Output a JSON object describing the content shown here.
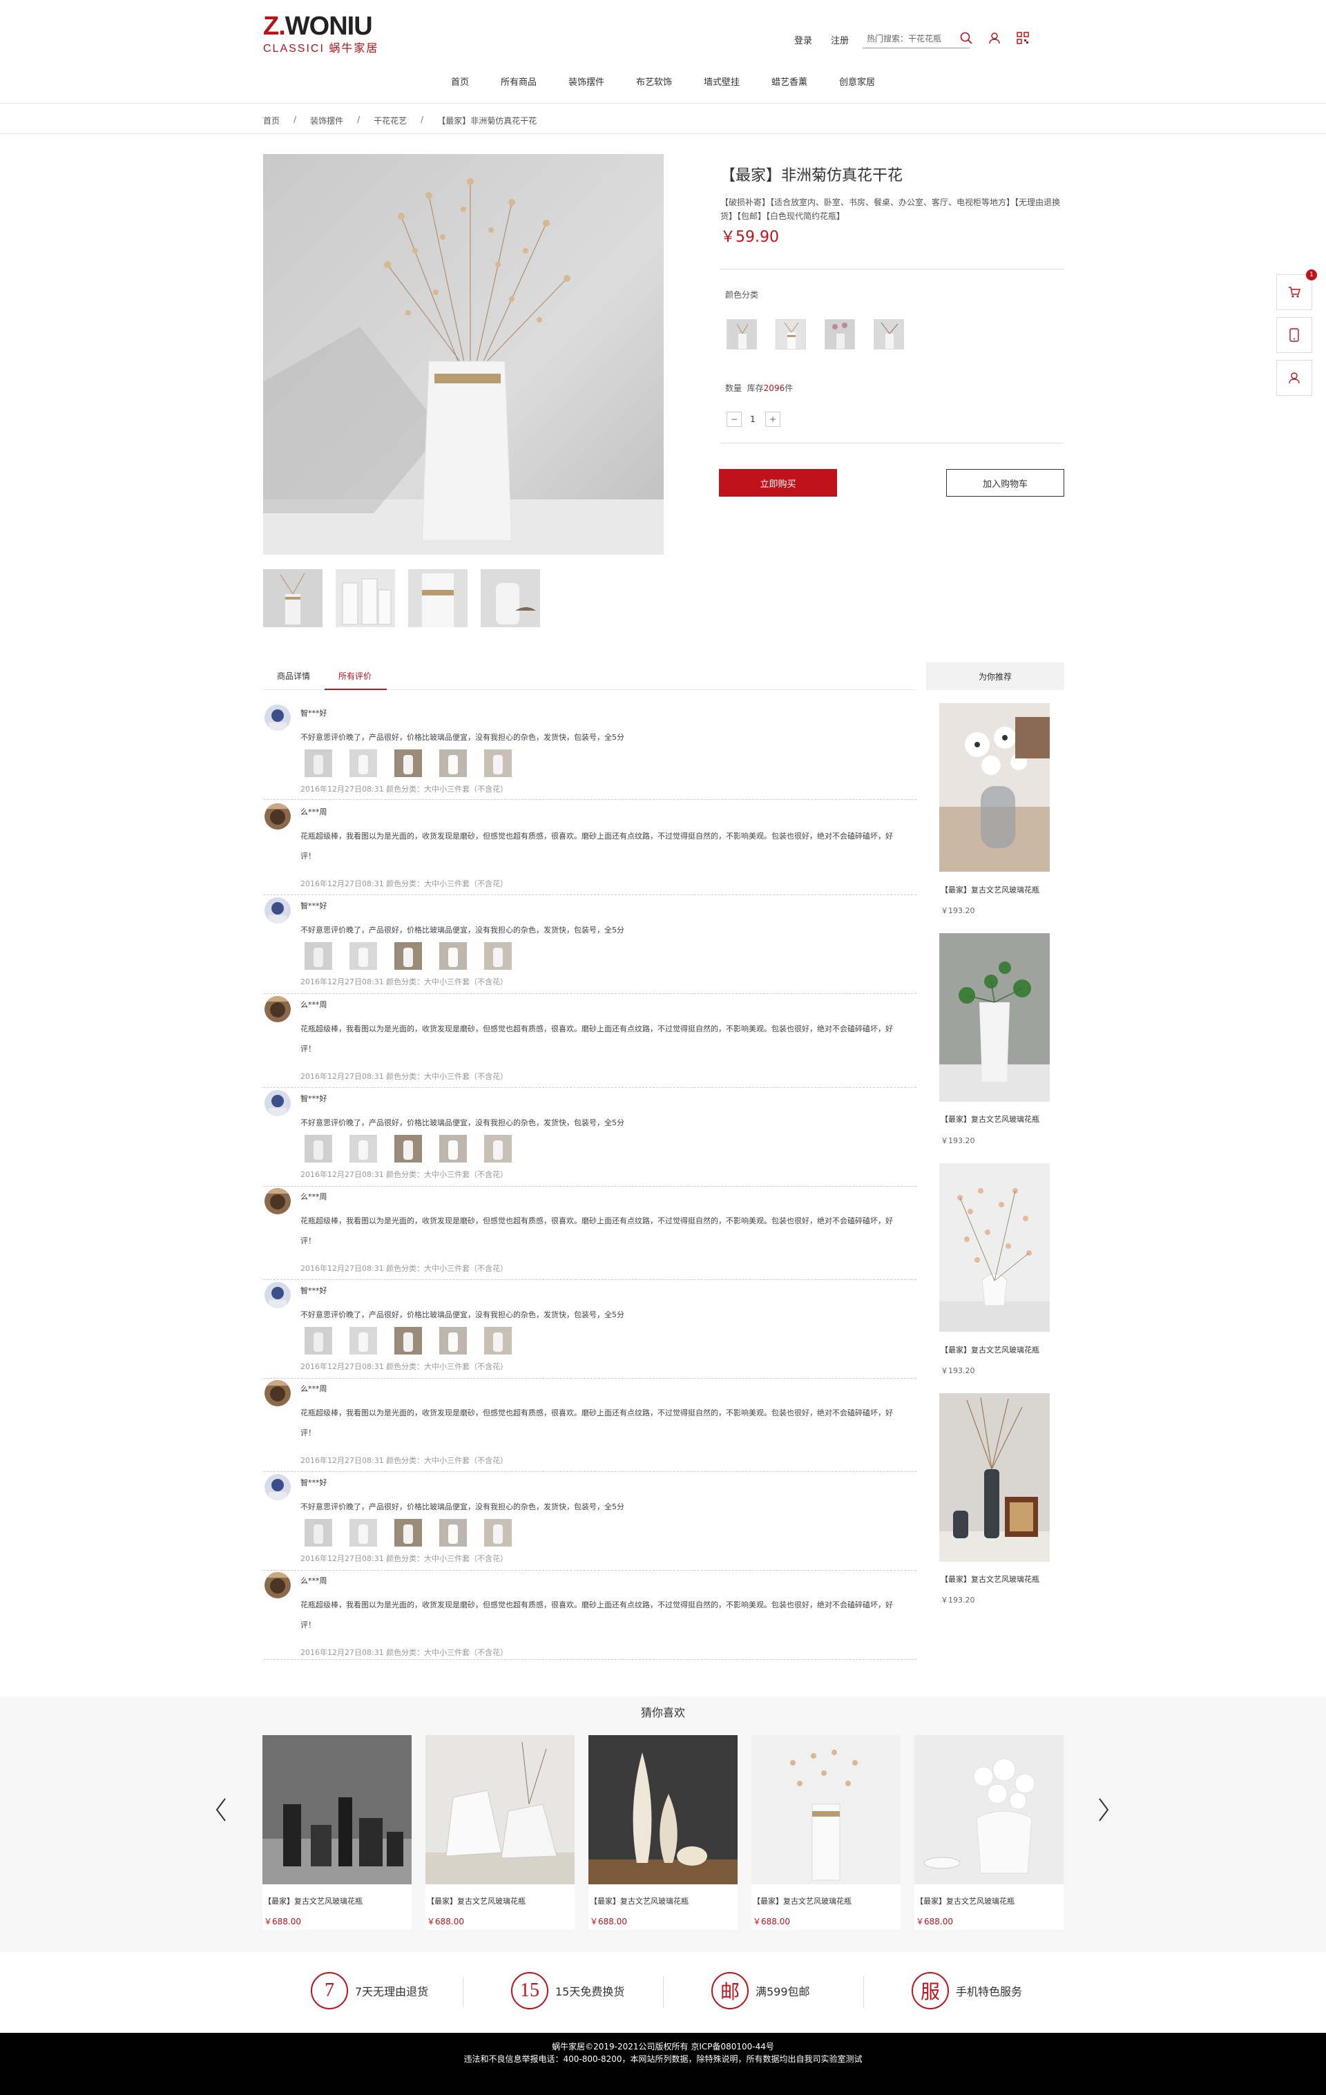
{
  "header": {
    "logo_main": "WONIU",
    "logo_letter": "Z.",
    "logo_sub": "CLASSICI 蜗牛家居",
    "login": "登录",
    "register": "注册",
    "search_text": "热门搜索：干花花瓶"
  },
  "nav": [
    "首页",
    "所有商品",
    "装饰摆件",
    "布艺软饰",
    "墙式壁挂",
    "蜡艺香薰",
    "创意家居"
  ],
  "breadcrumb": [
    "首页",
    "装饰摆件",
    "干花花艺",
    "【最家】非洲菊仿真花干花"
  ],
  "product": {
    "title": "【最家】非洲菊仿真花干花",
    "desc": "【破损补寄】【适合放室内、卧室、书房、餐桌、办公室、客厅、电视柜等地方】【无理由退换货】【包邮】【白色现代简约花瓶】",
    "price": "￥59.90",
    "color_label": "颜色分类",
    "qty_label": "数量",
    "stock_prefix": "库存",
    "stock_num": "2096",
    "stock_unit": "件",
    "qty": "1",
    "minus": "−",
    "plus": "+",
    "buy": "立即购买",
    "cart": "加入购物车"
  },
  "side_badge": "1",
  "tabs": [
    "商品详情",
    "所有评价"
  ],
  "reviews": {
    "a": {
      "name": "智***好",
      "text": "不好意思评价晚了，产品很好，价格比玻璃品便宜，没有我担心的杂色，发货快，包装号，全5分",
      "meta": "2016年12月27日08:31    颜色分类：大中小三件套（不含花）"
    },
    "b": {
      "name": "么***周",
      "text": "花瓶超级棒，我看图以为是光面的，收货发现是磨砂，但感觉也超有质感，很喜欢。磨砂上面还有点纹路，不过觉得挺自然的，不影响美观。包装也很好，绝对不会磕碎磕坏，好评！",
      "meta": "2016年12月27日08:31    颜色分类：大中小三件套（不含花）"
    }
  },
  "recommend": {
    "title": "为你推荐",
    "items": [
      {
        "name": "【最家】复古文艺风玻璃花瓶",
        "price": "￥193.20"
      },
      {
        "name": "【最家】复古文艺风玻璃花瓶",
        "price": "￥193.20"
      },
      {
        "name": "【最家】复古文艺风玻璃花瓶",
        "price": "￥193.20"
      },
      {
        "name": "【最家】复古文艺风玻璃花瓶",
        "price": "￥193.20"
      }
    ]
  },
  "guess": {
    "title": "猜你喜欢",
    "items": [
      {
        "name": "【最家】复古文艺风玻璃花瓶",
        "price": "￥688.00"
      },
      {
        "name": "【最家】复古文艺风玻璃花瓶",
        "price": "￥688.00"
      },
      {
        "name": "【最家】复古文艺风玻璃花瓶",
        "price": "￥688.00"
      },
      {
        "name": "【最家】复古文艺风玻璃花瓶",
        "price": "￥688.00"
      },
      {
        "name": "【最家】复古文艺风玻璃花瓶",
        "price": "￥688.00"
      }
    ]
  },
  "services": [
    {
      "icon": "7",
      "text": "7天无理由退货"
    },
    {
      "icon": "15",
      "text": "15天免费换货"
    },
    {
      "icon": "邮",
      "text": "满599包邮"
    },
    {
      "icon": "服",
      "text": "手机特色服务"
    }
  ],
  "footer": {
    "line1": "蜗牛家居©2019-2021公司版权所有 京ICP备080100-44号",
    "line2": "违法和不良信息举报电话：400-800-8200，本网站所列数据，除特殊说明，所有数据均出自我司实验室测试"
  },
  "colors": {
    "accent": "#c0121b"
  }
}
